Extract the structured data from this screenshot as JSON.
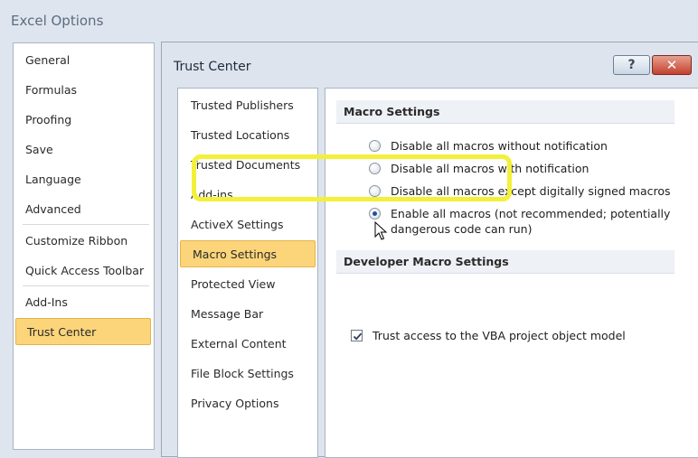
{
  "window": {
    "title": "Excel Options"
  },
  "outer_nav": {
    "items": [
      "General",
      "Formulas",
      "Proofing",
      "Save",
      "Language",
      "Advanced",
      "Customize Ribbon",
      "Quick Access Toolbar",
      "Add-Ins",
      "Trust Center"
    ],
    "selected": "Trust Center"
  },
  "dialog": {
    "title": "Trust Center",
    "help_label": "?",
    "close_label": "✕"
  },
  "trust_center_nav": {
    "items": [
      "Trusted Publishers",
      "Trusted Locations",
      "Trusted Documents",
      "Add-ins",
      "ActiveX Settings",
      "Macro Settings",
      "Protected View",
      "Message Bar",
      "External Content",
      "File Block Settings",
      "Privacy Options"
    ],
    "selected": "Macro Settings"
  },
  "macro_settings": {
    "header": "Macro Settings",
    "options": [
      {
        "line1": "Disable all macros without notification",
        "line2": "",
        "checked": false
      },
      {
        "line1": "Disable all macros with notification",
        "line2": "",
        "checked": false
      },
      {
        "line1": "Disable all macros except digitally signed macros",
        "line2": "",
        "checked": false
      },
      {
        "line1": "Enable all macros (not recommended; potentially",
        "line2": "dangerous code can run)",
        "checked": true
      }
    ]
  },
  "developer_macro_settings": {
    "header": "Developer Macro Settings",
    "checkbox_label": "Trust access to the VBA project object model",
    "checked": true
  },
  "colors": {
    "selected_fill": "#fcd57a",
    "highlight": "#f3f03a",
    "close_button": "#c4412f"
  },
  "icons": {
    "help": "help-icon",
    "close": "close-icon",
    "cursor": "mouse-pointer-icon"
  }
}
